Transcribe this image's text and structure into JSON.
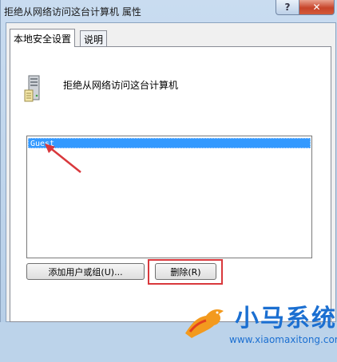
{
  "window": {
    "title": "拒绝从网络访问这台计算机 属性",
    "help_label": "?",
    "close_label": "✕"
  },
  "tabs": [
    {
      "label": "本地安全设置",
      "selected": true
    },
    {
      "label": "说明",
      "selected": false
    }
  ],
  "policy": {
    "icon": "server-computer-icon",
    "name": "拒绝从网络访问这台计算机"
  },
  "list": {
    "items": [
      {
        "label": "Guest",
        "selected": true
      }
    ]
  },
  "buttons": {
    "add_label": "添加用户或组(U)...",
    "remove_label": "删除(R)"
  },
  "watermark": {
    "title": "小马系统",
    "url": "www.xiaomaxitong.com"
  },
  "colors": {
    "selection": "#3399ff",
    "annotation": "#d9383c",
    "watermark": "#1b6fd1"
  }
}
